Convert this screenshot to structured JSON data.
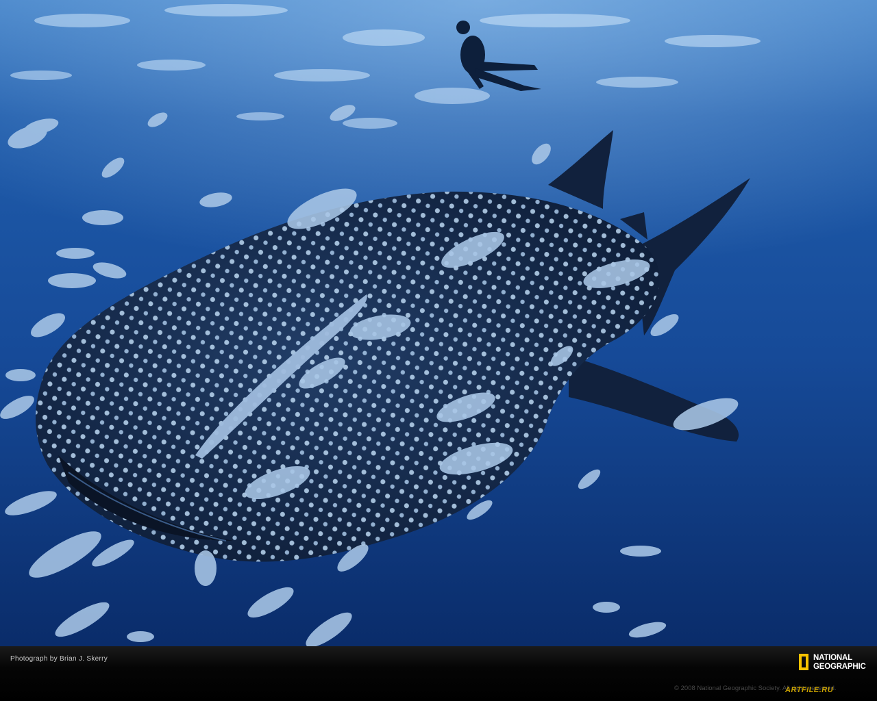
{
  "photo": {
    "subject": "whale-shark",
    "colors": {
      "water_deep": "#0b2f6e",
      "water_mid": "#1c57a8",
      "water_surface": "#7fb2e3",
      "shark_skin": "#14284a",
      "spots": "#bcd8f2",
      "fish": "#a9c6e6"
    }
  },
  "caption": {
    "credit": "Photograph by Brian J. Skerry",
    "logo_line1": "NATIONAL",
    "logo_line2": "GEOGRAPHIC",
    "logo_color": "#f6c200",
    "copyright": "© 2008 National Geographic Society. All rights reserved.",
    "watermark": "ARTFILE.RU"
  }
}
